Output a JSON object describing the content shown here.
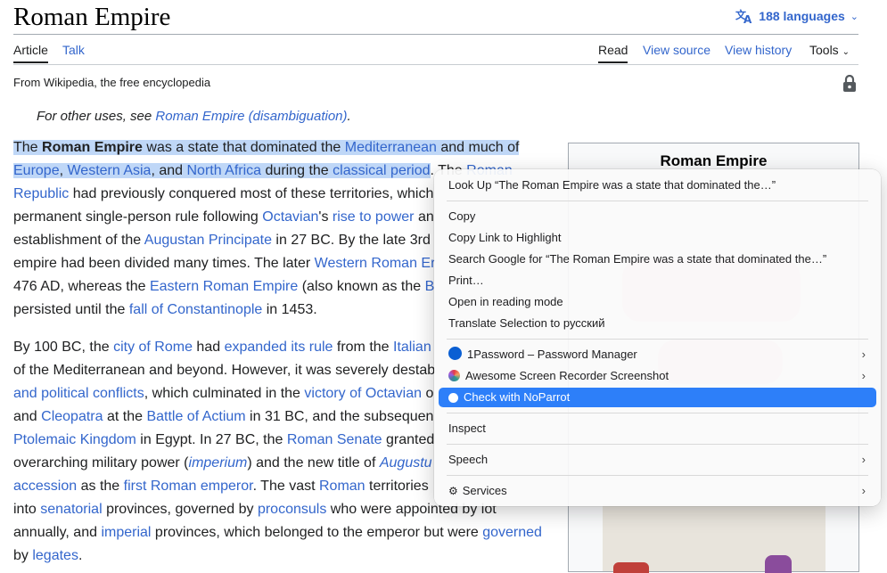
{
  "page": {
    "title": "Roman Empire",
    "languages_label": "188 languages",
    "from_line": "From Wikipedia, the free encyclopedia",
    "hatnote_prefix": "For other uses, see ",
    "hatnote_link": "Roman Empire (disambiguation)",
    "hatnote_suffix": "."
  },
  "tabs": {
    "article": "Article",
    "talk": "Talk",
    "read": "Read",
    "view_source": "View source",
    "view_history": "View history",
    "tools": "Tools"
  },
  "para1": [
    [
      {
        "t": "The ",
        "h": 1
      },
      {
        "t": "Roman Empire",
        "b": 1,
        "h": 1
      },
      {
        "t": " was a state that dominated the ",
        "h": 1
      },
      {
        "t": "Mediterranean",
        "l": 1,
        "h": 1
      },
      {
        "t": " and much of",
        "h": 1
      }
    ],
    [
      {
        "t": "Europe",
        "l": 1,
        "h": 1
      },
      {
        "t": ", ",
        "h": 1
      },
      {
        "t": "Western Asia",
        "l": 1,
        "h": 1
      },
      {
        "t": ", and ",
        "h": 1
      },
      {
        "t": "North Africa",
        "l": 1,
        "h": 1
      },
      {
        "t": " during the ",
        "h": 1
      },
      {
        "t": "classical period",
        "l": 1,
        "h": 1
      },
      {
        "t": ". The "
      },
      {
        "t": "Roman",
        "l": 1
      }
    ],
    [
      {
        "t": "Republic",
        "l": 1
      },
      {
        "t": " had previously conquered most of these territories, which"
      }
    ],
    [
      {
        "t": "permanent single-person rule following "
      },
      {
        "t": "Octavian",
        "l": 1
      },
      {
        "t": "'s "
      },
      {
        "t": "rise to power",
        "l": 1
      },
      {
        "t": " an"
      }
    ],
    [
      {
        "t": "establishment of the "
      },
      {
        "t": "Augustan Principate",
        "l": 1
      },
      {
        "t": " in 27 BC. By the late 3rd"
      }
    ],
    [
      {
        "t": "empire had been divided many times. The later "
      },
      {
        "t": "Western Roman Er",
        "l": 1
      }
    ],
    [
      {
        "t": "476 AD, whereas the "
      },
      {
        "t": "Eastern Roman Empire",
        "l": 1
      },
      {
        "t": " (also known as the "
      },
      {
        "t": "B",
        "l": 1
      }
    ],
    [
      {
        "t": "persisted until the "
      },
      {
        "t": "fall of Constantinople",
        "l": 1
      },
      {
        "t": " in 1453."
      }
    ]
  ],
  "para2": [
    [
      {
        "t": "By 100 BC, the "
      },
      {
        "t": "city of Rome",
        "l": 1
      },
      {
        "t": " had "
      },
      {
        "t": "expanded its rule",
        "l": 1
      },
      {
        "t": " from the "
      },
      {
        "t": "Italian",
        "l": 1
      }
    ],
    [
      {
        "t": "of the Mediterranean and beyond. However, it was severely destab"
      }
    ],
    [
      {
        "t": "and political conflicts",
        "l": 1
      },
      {
        "t": ", which culminated in the "
      },
      {
        "t": "victory of Octavian",
        "l": 1
      },
      {
        "t": " o"
      }
    ],
    [
      {
        "t": "and "
      },
      {
        "t": "Cleopatra",
        "l": 1
      },
      {
        "t": " at the "
      },
      {
        "t": "Battle of Actium",
        "l": 1
      },
      {
        "t": " in 31 BC, and the subsequen"
      }
    ],
    [
      {
        "t": "Ptolemaic Kingdom",
        "l": 1
      },
      {
        "t": " in Egypt. In 27 BC, the "
      },
      {
        "t": "Roman Senate",
        "l": 1
      },
      {
        "t": " granted"
      }
    ],
    [
      {
        "t": "overarching military power ("
      },
      {
        "t": "imperium",
        "l": 1,
        "i": 1
      },
      {
        "t": ") and the new title of "
      },
      {
        "t": "Augustu",
        "l": 1,
        "i": 1
      }
    ],
    [
      {
        "t": "accession",
        "l": 1
      },
      {
        "t": " as the "
      },
      {
        "t": "first Roman emperor",
        "l": 1
      },
      {
        "t": ". The vast "
      },
      {
        "t": "Roman",
        "l": 1
      },
      {
        "t": " territories"
      }
    ],
    [
      {
        "t": "into "
      },
      {
        "t": "senatorial",
        "l": 1
      },
      {
        "t": " provinces, governed by "
      },
      {
        "t": "proconsuls",
        "l": 1
      },
      {
        "t": " who were appointed by lot"
      }
    ],
    [
      {
        "t": "annually, and "
      },
      {
        "t": "imperial",
        "l": 1
      },
      {
        "t": " provinces, which belonged to the emperor but were "
      },
      {
        "t": "governed",
        "l": 1
      }
    ],
    [
      {
        "t": "by "
      },
      {
        "t": "legates",
        "l": 1
      },
      {
        "t": "."
      }
    ]
  ],
  "infobox": {
    "title": "Roman Empire"
  },
  "context_menu": {
    "look_up": "Look Up “The Roman Empire was a state that dominated the…”",
    "copy": "Copy",
    "copy_link": "Copy Link to Highlight",
    "search_google": "Search Google for “The Roman Empire was a state that dominated the…”",
    "print": "Print…",
    "reading_mode": "Open in reading mode",
    "translate": "Translate Selection to русский",
    "onepassword": "1Password – Password Manager",
    "recorder": "Awesome Screen Recorder  Screenshot",
    "noparrot": "Check with NoParrot",
    "inspect": "Inspect",
    "speech": "Speech",
    "services": "Services"
  },
  "colors": {
    "link": "#3366cc",
    "highlight": "#bfd7f7",
    "menu_active": "#2d7ff9"
  }
}
